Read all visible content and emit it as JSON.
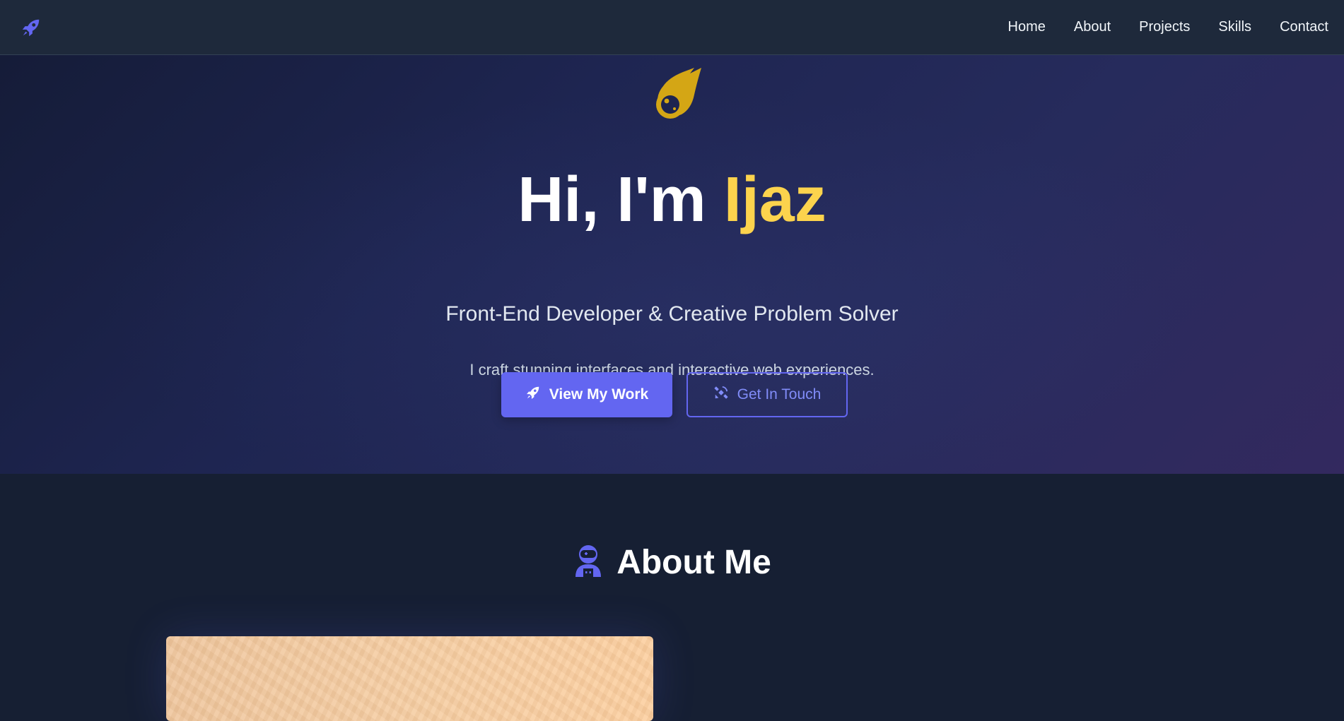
{
  "nav": {
    "logo_icon": "rocket-icon",
    "links": [
      "Home",
      "About",
      "Projects",
      "Skills",
      "Contact"
    ]
  },
  "hero": {
    "icon": "meteor-icon",
    "title_prefix": "Hi, I'm ",
    "title_name": "Ijaz",
    "subtitle": "Front-End Developer & Creative Problem Solver",
    "description": "I craft stunning interfaces and interactive web experiences.",
    "primary_button": {
      "label": "View My Work",
      "icon": "rocket-icon"
    },
    "secondary_button": {
      "label": "Get In Touch",
      "icon": "satellite-icon"
    }
  },
  "about": {
    "icon": "astronaut-icon",
    "title": "About Me"
  },
  "colors": {
    "accent": "#6366f1",
    "highlight": "#fcd34d",
    "meteor": "#d4a615",
    "nav_bg": "#1e293b",
    "page_bg": "#161f33"
  }
}
